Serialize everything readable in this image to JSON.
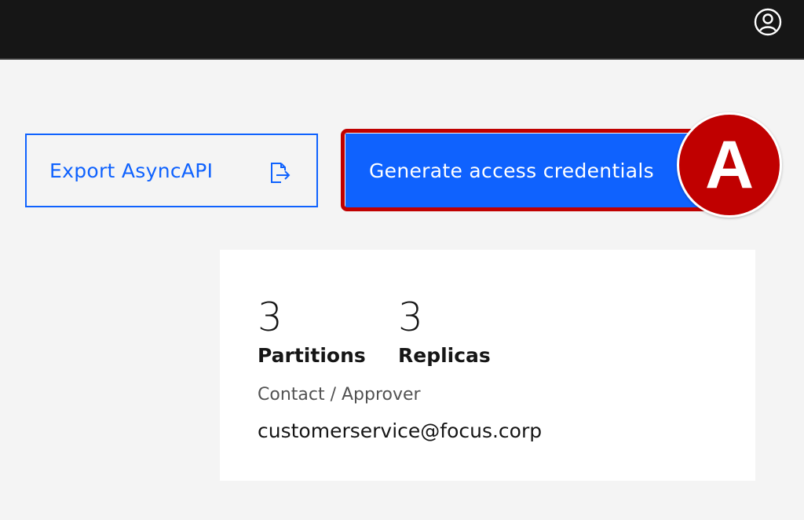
{
  "header": {
    "user_icon": "user-avatar-icon"
  },
  "actions": {
    "export_label": "Export AsyncAPI",
    "export_icon": "document-export-icon",
    "generate_label": "Generate access credentials",
    "annotation_marker": "A",
    "annotation_color": "#c00000",
    "accent_color": "#0f62fe"
  },
  "details": {
    "partitions_value": "3",
    "partitions_label": "Partitions",
    "replicas_value": "3",
    "replicas_label": "Replicas",
    "contact_label": "Contact / Approver",
    "contact_value": "customerservice@focus.corp"
  }
}
